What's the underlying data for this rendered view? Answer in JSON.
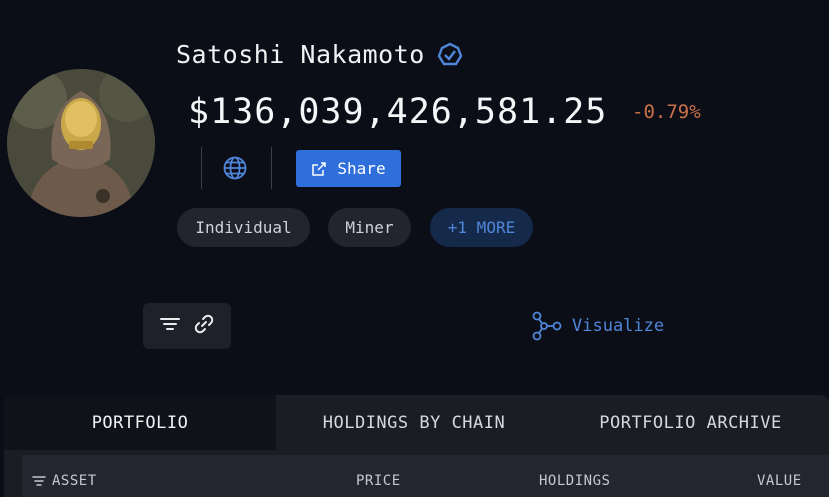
{
  "profile": {
    "name": "Satoshi Nakamoto",
    "verified_icon": "verified-badge-icon",
    "balance": "$136,039,426,581.25",
    "change": "-0.79%",
    "change_color": "#c9714b"
  },
  "actions": {
    "website_icon": "globe-icon",
    "share_label": "Share",
    "share_color": "#2f6fdc"
  },
  "tags": [
    {
      "label": "Individual"
    },
    {
      "label": "Miner"
    },
    {
      "label": "+1 MORE"
    }
  ],
  "toolbar": {
    "filter_icon": "filter-icon",
    "link_icon": "link-icon",
    "visualize_label": "Visualize"
  },
  "tabs": [
    {
      "label": "PORTFOLIO",
      "active": true
    },
    {
      "label": "HOLDINGS BY CHAIN",
      "active": false
    },
    {
      "label": "PORTFOLIO ARCHIVE",
      "active": false
    }
  ],
  "table": {
    "columns": [
      "ASSET",
      "PRICE",
      "HOLDINGS",
      "VALUE"
    ]
  },
  "colors": {
    "background": "#0b0e17",
    "accent": "#4f86d9"
  }
}
